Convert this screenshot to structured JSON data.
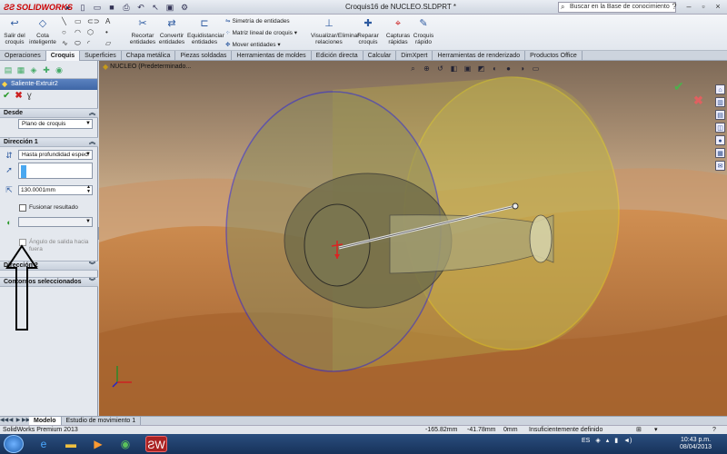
{
  "app": {
    "logo_text": "SOLIDWORKS",
    "document_title": "Croquis16 de NUCLEO.SLDPRT *",
    "search_placeholder": "Buscar en la Base de conocimiento"
  },
  "ribbon": {
    "salir": "Salir del croquis",
    "cota": "Cota inteligente",
    "recortar": "Recortar entidades",
    "convertir": "Convertir entidades",
    "equidistanciar": "Equidistanciar entidades",
    "simetria": "Simetría de entidades",
    "matriz": "Matriz lineal de croquis",
    "mover": "Mover entidades",
    "visualizar": "Visualizar/Eliminar relaciones",
    "reparar": "Reparar croquis",
    "capturas": "Capturas rápidas",
    "croquis_rapido": "Croquis rápido"
  },
  "command_tabs": [
    "Operaciones",
    "Croquis",
    "Superficies",
    "Chapa metálica",
    "Piezas soldadas",
    "Herramientas de moldes",
    "Edición directa",
    "Calcular",
    "DimXpert",
    "Herramientas de renderizado",
    "Productos Office"
  ],
  "active_tab": "Croquis",
  "property_manager": {
    "title": "Saliente-Extruir2",
    "desde_header": "Desde",
    "desde_value": "Plano de croquis",
    "direccion1_header": "Dirección 1",
    "end_condition": "Hasta profundidad especi",
    "depth": "130.0001mm",
    "fusionar": "Fusionar resultado",
    "angulo": "Ángulo de salida hacia fuera",
    "direccion2_header": "Dirección 2",
    "contornos_header": "Contornos seleccionados"
  },
  "viewport": {
    "tree_root": "NUCLEO  (Predeterminado..."
  },
  "bottom_tabs": [
    "Modelo",
    "Estudio de movimiento 1"
  ],
  "status": {
    "product": "SolidWorks Premium 2013",
    "x": "-165.82mm",
    "y": "-41.78mm",
    "z": "0mm",
    "state": "Insuficientemente definido"
  },
  "taskbar": {
    "language": "ES",
    "time": "10:43 p.m.",
    "date": "08/04/2013"
  },
  "colors": {
    "front_circle": "#2a2ad8",
    "back_circle": "#f0e020",
    "accent_header": "#3e66a6"
  }
}
